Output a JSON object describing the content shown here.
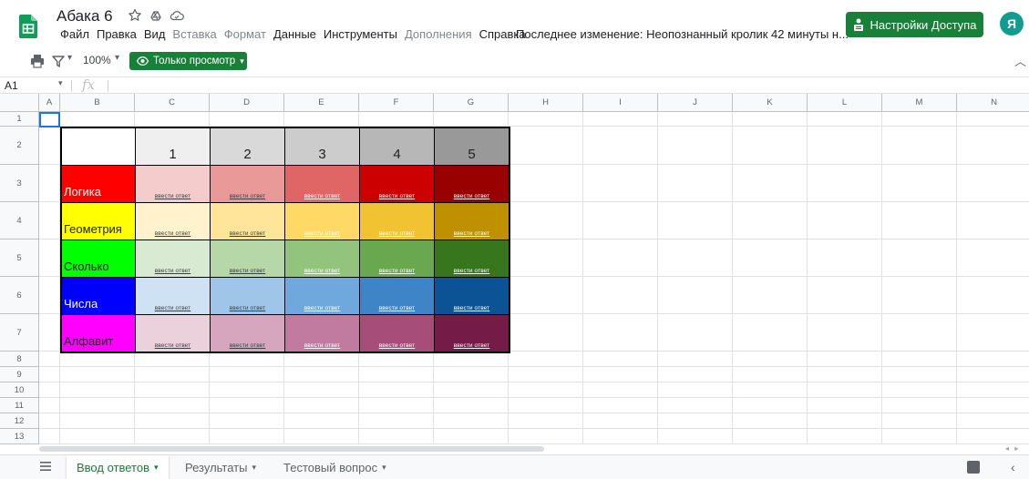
{
  "document": {
    "title": "Абака 6",
    "last_edit": "Последнее изменение: Неопознанный кролик 42 минуты н..."
  },
  "menu": [
    {
      "label": "Файл",
      "disabled": false
    },
    {
      "label": "Правка",
      "disabled": false
    },
    {
      "label": "Вид",
      "disabled": false
    },
    {
      "label": "Вставка",
      "disabled": true
    },
    {
      "label": "Формат",
      "disabled": true
    },
    {
      "label": "Данные",
      "disabled": false
    },
    {
      "label": "Инструменты",
      "disabled": false
    },
    {
      "label": "Дополнения",
      "disabled": true
    },
    {
      "label": "Справка",
      "disabled": false
    }
  ],
  "share": {
    "label": "Настройки Доступа"
  },
  "avatar": {
    "letter": "Я"
  },
  "toolbar": {
    "zoom": "100%",
    "view_only": "Только просмотр"
  },
  "formula_bar": {
    "cell_ref": "A1",
    "fx": "fx"
  },
  "columns": [
    "A",
    "B",
    "C",
    "D",
    "E",
    "F",
    "G",
    "H",
    "I",
    "J",
    "K",
    "L",
    "M",
    "N"
  ],
  "rows": [
    "1",
    "2",
    "3",
    "4",
    "5",
    "6",
    "7",
    "8",
    "9",
    "10",
    "11",
    "12",
    "13"
  ],
  "table": {
    "header_numbers": [
      "1",
      "2",
      "3",
      "4",
      "5"
    ],
    "header_colors": [
      "#efefef",
      "#d9d9d9",
      "#cccccc",
      "#b7b7b7",
      "#999999"
    ],
    "link_text": "ввести ответ",
    "categories": [
      {
        "label": "Логика",
        "color": "#ff0000",
        "text_color": "#ffffff",
        "shades": [
          "#f4cccc",
          "#ea9999",
          "#e06666",
          "#cc0000",
          "#990000"
        ],
        "link_colors": [
          "#3c4043",
          "#3c4043",
          "#ffffff",
          "#ffffff",
          "#ffffff"
        ]
      },
      {
        "label": "Геометрия",
        "color": "#ffff00",
        "text_color": "#202124",
        "shades": [
          "#fff2cc",
          "#ffe599",
          "#ffd966",
          "#f1c232",
          "#bf9000"
        ],
        "link_colors": [
          "#3c4043",
          "#3c4043",
          "#ffffff",
          "#ffffff",
          "#ffffff"
        ]
      },
      {
        "label": "Сколько",
        "color": "#00ff00",
        "text_color": "#202124",
        "shades": [
          "#d9ead3",
          "#b6d7a8",
          "#93c47d",
          "#6aa84f",
          "#38761d"
        ],
        "link_colors": [
          "#3c4043",
          "#3c4043",
          "#ffffff",
          "#ffffff",
          "#ffffff"
        ]
      },
      {
        "label": "Числа",
        "color": "#0000ff",
        "text_color": "#ffffff",
        "shades": [
          "#cfe2f3",
          "#9fc5e8",
          "#6fa8dc",
          "#3d85c6",
          "#0b5394"
        ],
        "link_colors": [
          "#3c4043",
          "#3c4043",
          "#ffffff",
          "#ffffff",
          "#ffffff"
        ]
      },
      {
        "label": "Алфавит",
        "color": "#ff00ff",
        "text_color": "#202124",
        "shades": [
          "#ead1dc",
          "#d5a6bd",
          "#c27ba0",
          "#a64d79",
          "#741b47"
        ],
        "link_colors": [
          "#3c4043",
          "#3c4043",
          "#ffffff",
          "#ffffff",
          "#ffffff"
        ]
      }
    ]
  },
  "sheet_tabs": [
    {
      "label": "Ввод ответов",
      "active": true
    },
    {
      "label": "Результаты",
      "active": false
    },
    {
      "label": "Тестовый вопрос",
      "active": false
    }
  ],
  "colors": {
    "brand_green": "#188038",
    "selection": "#1a73e8"
  }
}
